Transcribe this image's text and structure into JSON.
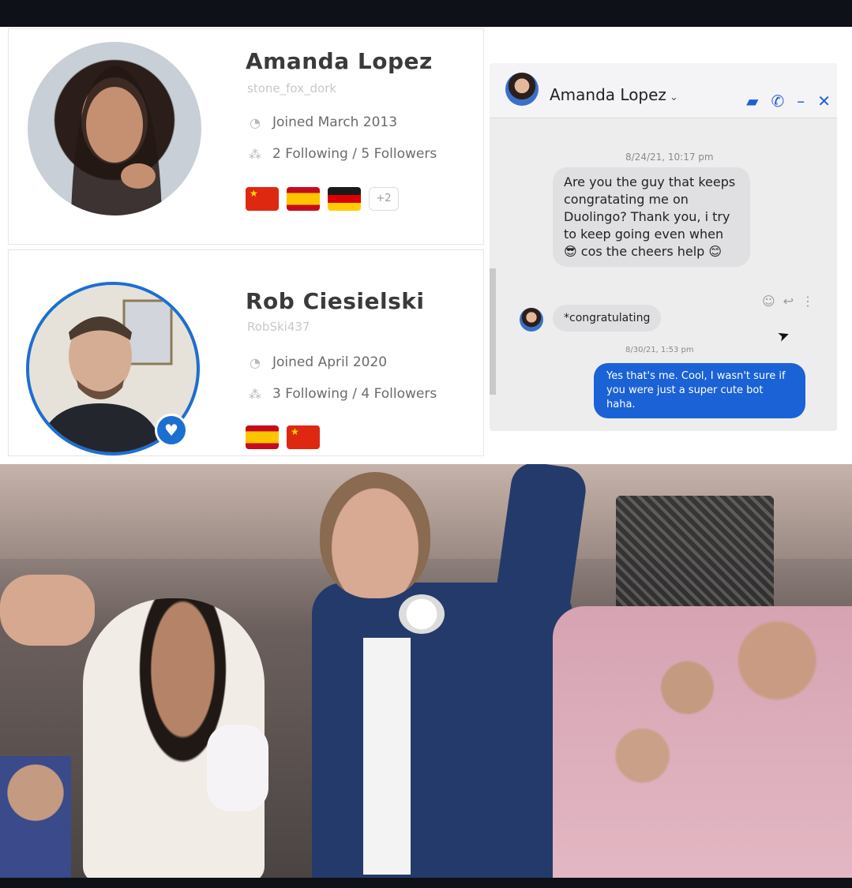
{
  "profiles": [
    {
      "name": "Amanda Lopez",
      "username": "stone_fox_dork",
      "joined": "Joined March 2013",
      "follow": "2 Following / 5 Followers",
      "flags": [
        "chinese-flag",
        "spanish-flag",
        "german-flag"
      ],
      "more_flags": "+2"
    },
    {
      "name": "Rob Ciesielski",
      "username": "RobSki437",
      "joined": "Joined April 2020",
      "follow": "3 Following / 4 Followers",
      "flags": [
        "spanish-flag",
        "chinese-flag"
      ]
    }
  ],
  "messenger": {
    "contact_name": "Amanda Lopez",
    "messages": [
      {
        "timestamp": "8/24/21, 10:17 pm",
        "text": "Are you the guy that keeps congratating me on Duolingo? Thank you, i try to keep going even when 😎 cos the cheers help 😊",
        "direction": "incoming"
      },
      {
        "text": "*congratulating",
        "direction": "incoming"
      },
      {
        "timestamp": "8/30/21, 1:53 pm",
        "text": "Yes that's me. Cool, I wasn't sure if you were just a super cute bot haha.",
        "direction": "outgoing"
      }
    ],
    "colors": {
      "accent": "#1a62d6",
      "incoming_bubble": "#e0e0e2"
    }
  },
  "photo": {
    "subject": "wedding-photo"
  }
}
